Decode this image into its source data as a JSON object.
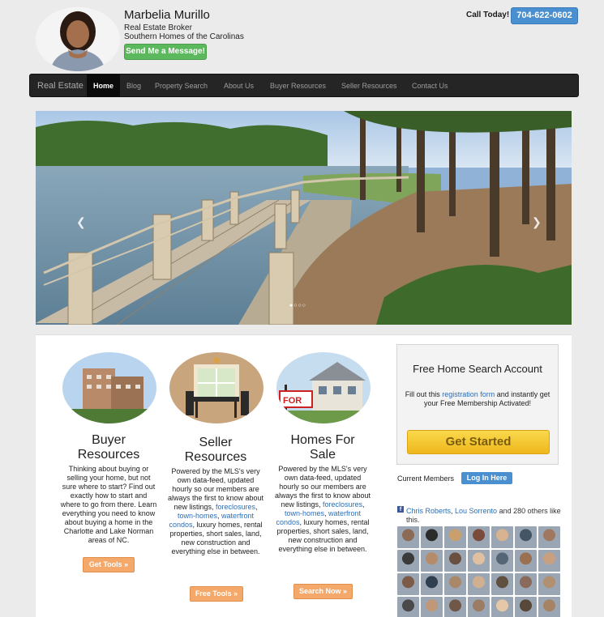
{
  "header": {
    "name": "Marbelia Murillo",
    "title_line1": "Real Estate Broker",
    "title_line2": "Southern Homes of the Carolinas",
    "message_button": "Send Me a Message!",
    "call_label": "Call Today!",
    "phone": "704-622-0602"
  },
  "nav": {
    "brand": "Real Estate",
    "items": [
      "Home",
      "Blog",
      "Property Search",
      "About Us",
      "Buyer Resources",
      "Seller Resources",
      "Contact Us"
    ],
    "active": "Home"
  },
  "hero": {
    "prev_icon": "chevron-left-icon",
    "next_icon": "chevron-right-icon",
    "dots": "●○○○"
  },
  "columns": [
    {
      "title_line1": "Buyer",
      "title_line2": "Resources",
      "text": "Thinking about buying or selling your home, but not sure where to start? Find out exactly how to start and where to go from there. Learn everything you need to know about buying a home in the Charlotte and Lake Norman areas of NC.",
      "button": "Get Tools »"
    },
    {
      "title_line1": "Seller",
      "title_line2": "Resources",
      "text_before": "Powered by the MLS's very own data-feed, updated hourly so our members are always the first to know about new listings,",
      "link1": "foreclosures",
      "link2": "town-homes",
      "link3": "waterfront condos",
      "text_after": ", luxury homes, rental properties, short sales, land, new construction and everything else in between.",
      "button": "Free Tools »"
    },
    {
      "title_line1": "Homes For",
      "title_line2": "Sale",
      "text_before": "Powered by the MLS's very own data-feed, updated hourly so our members are always the first to know about new listings,",
      "link1": "foreclosures",
      "link2": "town-homes",
      "link3": "waterfront condos",
      "text_after": ", luxury homes, rental properties, short sales, land, new construction and everything else in between.",
      "button": "Search Now »"
    }
  ],
  "sidebar": {
    "title": "Free Home Search Account",
    "text_before": "Fill out this",
    "link": "registration form",
    "text_after": "and instantly get your Free Membership Activated!",
    "button": "Get Started",
    "members_label": "Current Members",
    "login_button": "Log In Here",
    "fb_icon": "facebook-icon",
    "fb_name1": "Chris Roberts",
    "fb_name2": "Lou Sorrento",
    "fb_rest": "and 280 others like this."
  },
  "colors": {
    "nav_bg": "#252525",
    "green_button": "#5cb85c",
    "blue_button": "#4a8fcf",
    "orange_button": "#f4a86a",
    "yellow_button": "#f4c630",
    "link": "#2a6fb8"
  }
}
